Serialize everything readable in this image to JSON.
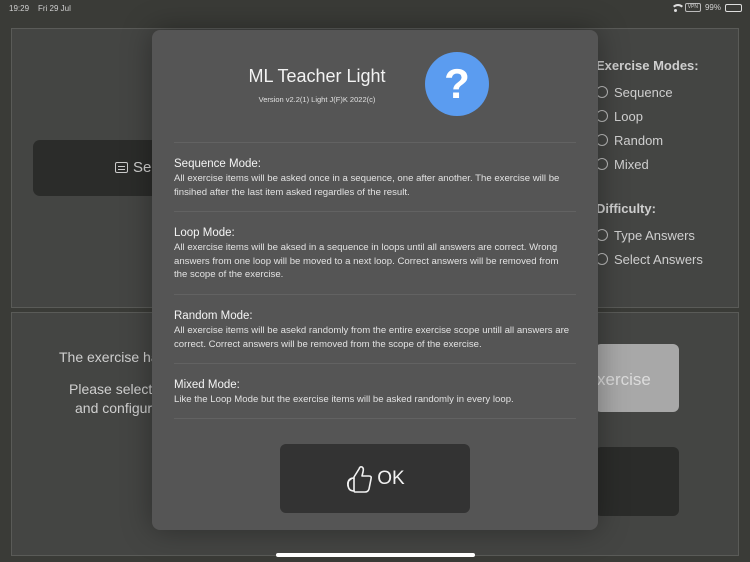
{
  "status_bar": {
    "time": "19:29",
    "date": "Fri 29 Jul",
    "vpn_label": "VPN",
    "battery_percent": "99%",
    "icons": [
      "wifi-icon",
      "vpn-icon",
      "battery-icon"
    ]
  },
  "background": {
    "select_button_label": "Sel",
    "exercise_modes": {
      "header": "Exercise Modes:",
      "options": [
        "Sequence",
        "Loop",
        "Random",
        "Mixed"
      ]
    },
    "difficulty": {
      "header": "Difficulty:",
      "options": [
        "Type Answers",
        "Select Answers"
      ]
    },
    "message_line1": "The exercise ha",
    "message_line2": "Please select",
    "message_line3": "and configur",
    "start_button_label": "xercise"
  },
  "modal": {
    "title": "ML Teacher Light",
    "version": "Version v2.2(1) Light J(F)K 2022(c)",
    "help_icon": "?",
    "sections": [
      {
        "title": "Sequence Mode:",
        "text": "All exercise items will be asked once in a sequence, one after another. The exercise will be finsihed after the last item asked regardles of the result."
      },
      {
        "title": "Loop Mode:",
        "text": "All exercise items will be aksed in a sequence in loops until all answers are correct. Wrong answers from one loop will be moved to a next loop. Correct answers will be removed from the scope of the exercise."
      },
      {
        "title": "Random Mode:",
        "text": "All exercise items will be asekd randomly from the entire exercise scope untill all answers are correct. Correct answers will be removed from the scope of the exercise."
      },
      {
        "title": "Mixed Mode:",
        "text": "Like the Loop Mode but the exercise items will be asked randomly in every loop."
      }
    ],
    "ok_button_label": "OK"
  },
  "colors": {
    "accent_help": "#5b9cf0",
    "modal_bg": "#555555",
    "ok_button_bg": "#333333"
  }
}
